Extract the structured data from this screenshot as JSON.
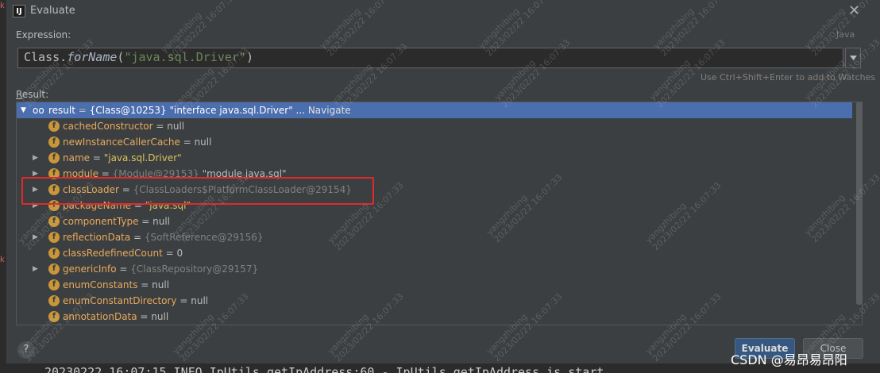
{
  "window": {
    "title": "Evaluate",
    "close_icon": "close-icon"
  },
  "expression": {
    "label": "Expression:",
    "language": "Java",
    "value_prefix": "Class.",
    "value_fn": "forName",
    "value_open": "(",
    "value_string": "\"java.sql.Driver\"",
    "value_close": ")",
    "hint": "Use Ctrl+Shift+Enter to add to Watches"
  },
  "result": {
    "label_first": "R",
    "label_rest": "esult:",
    "root": {
      "name": "result",
      "eq": " = ",
      "value": "{Class@10253} \"interface java.sql.Driver\" ...",
      "link": "Navigate"
    },
    "rows": [
      {
        "expandable": false,
        "name": "cachedConstructor",
        "eq": " = ",
        "value": "null",
        "kind": "plain"
      },
      {
        "expandable": false,
        "name": "newInstanceCallerCache",
        "eq": " = ",
        "value": "null",
        "kind": "plain"
      },
      {
        "expandable": true,
        "name": "name",
        "eq": " = ",
        "value": "\"java.sql.Driver\"",
        "kind": "string"
      },
      {
        "expandable": true,
        "name": "module",
        "eq": " = ",
        "value": "{Module@29153}",
        "extra": " \"module java.sql\"",
        "kind": "ref"
      },
      {
        "expandable": true,
        "name": "classLoader",
        "eq": " = ",
        "value": "{ClassLoaders$PlatformClassLoader@29154}",
        "kind": "ref"
      },
      {
        "expandable": true,
        "name": "packageName",
        "eq": " = ",
        "value": "\"java.sql\"",
        "kind": "string"
      },
      {
        "expandable": false,
        "name": "componentType",
        "eq": " = ",
        "value": "null",
        "kind": "plain"
      },
      {
        "expandable": true,
        "name": "reflectionData",
        "eq": " = ",
        "value": "{SoftReference@29156}",
        "kind": "ref"
      },
      {
        "expandable": false,
        "name": "classRedefinedCount",
        "eq": " = ",
        "value": "0",
        "kind": "plain"
      },
      {
        "expandable": true,
        "name": "genericInfo",
        "eq": " = ",
        "value": "{ClassRepository@29157}",
        "kind": "ref"
      },
      {
        "expandable": false,
        "name": "enumConstants",
        "eq": " = ",
        "value": "null",
        "kind": "plain"
      },
      {
        "expandable": false,
        "name": "enumConstantDirectory",
        "eq": " = ",
        "value": "null",
        "kind": "plain"
      },
      {
        "expandable": false,
        "name": "annotationData",
        "eq": " = ",
        "value": "null",
        "kind": "plain"
      }
    ]
  },
  "buttons": {
    "help": "?",
    "evaluate": "Evaluate",
    "close": "Close"
  },
  "console_text": "20230222 16:07:15 INFO  IpUtils.getIpAddress:60 - IpUtils.getIpAddress is start",
  "watermark": {
    "user": "yangzhibing",
    "time": "2023/02/22 16:07:33"
  },
  "csdn": "CSDN @易昂易昂阳",
  "colors": {
    "background": "#3c3f41",
    "selection": "#4b6eaf",
    "field_icon": "#c99739",
    "highlight_box": "#e02a2a",
    "evaluate_button": "#365880"
  }
}
